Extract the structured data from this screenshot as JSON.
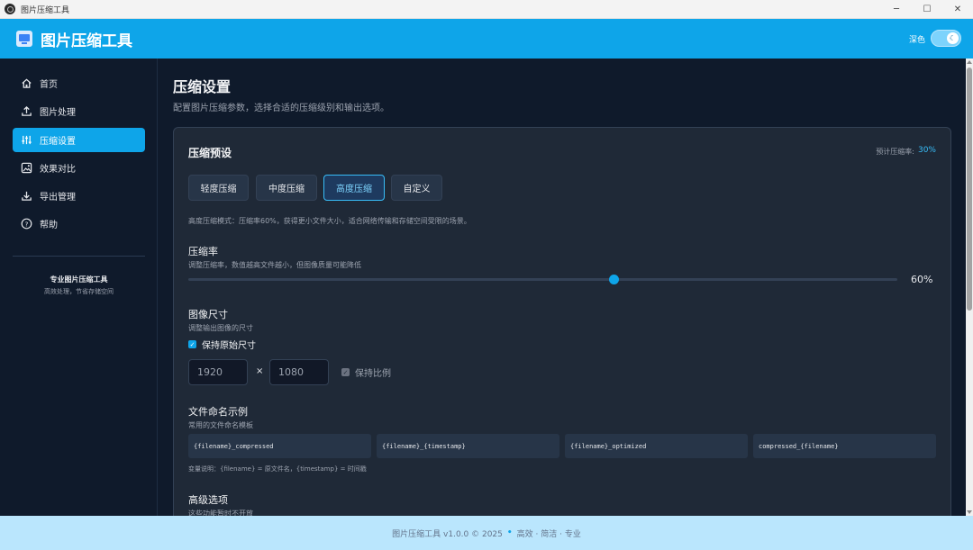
{
  "window": {
    "title": "图片压缩工具",
    "min_icon": "minimize-icon",
    "max_icon": "maximize-icon",
    "close_icon": "close-icon"
  },
  "header": {
    "app_name": "图片压缩工具",
    "theme_label": "深色",
    "theme_dark": true,
    "accent": "#0ea5e9"
  },
  "sidebar": {
    "items": [
      {
        "label": "首页",
        "icon": "home-icon"
      },
      {
        "label": "图片处理",
        "icon": "upload-icon"
      },
      {
        "label": "压缩设置",
        "icon": "sliders-icon",
        "active": true
      },
      {
        "label": "效果对比",
        "icon": "images-icon"
      },
      {
        "label": "导出管理",
        "icon": "download-icon"
      },
      {
        "label": "帮助",
        "icon": "help-icon"
      }
    ],
    "promo_title": "专业图片压缩工具",
    "promo_sub": "高效处理，节省存储空间"
  },
  "main": {
    "title": "压缩设置",
    "desc": "配置图片压缩参数，选择合适的压缩级别和输出选项。",
    "card_title": "压缩预设",
    "ratio_label": "预计压缩率:",
    "ratio_value": "30%",
    "presets": [
      "轻度压缩",
      "中度压缩",
      "高度压缩",
      "自定义"
    ],
    "active_preset": 2,
    "mode_desc": "高度压缩模式：压缩率60%，获得更小文件大小，适合网络传输和存储空间受限的场景。",
    "rate": {
      "title": "压缩率",
      "sub": "调整压缩率，数值越高文件越小，但图像质量可能降低",
      "value": 60,
      "value_label": "60%"
    },
    "size": {
      "title": "图像尺寸",
      "sub": "调整输出图像的尺寸",
      "keep_original_label": "保持原始尺寸",
      "keep_original": true,
      "width": "1920",
      "height": "1080",
      "times": "×",
      "keep_ratio_label": "保持比例",
      "keep_ratio": true
    },
    "naming": {
      "title": "文件命名示例",
      "sub": "常用的文件命名模板",
      "templates": [
        "{filename}_compressed",
        "{filename}_{timestamp}",
        "{filename}_optimized",
        "compressed_{filename}"
      ],
      "note": "变量说明：{filename} = 原文件名，{timestamp} = 时间戳"
    },
    "advanced": {
      "title": "高级选项",
      "sub": "这些功能暂时不开放"
    }
  },
  "footer": {
    "text": "图片压缩工具 v1.0.0 © 2025",
    "dot": "•",
    "tagline": "高效 · 简洁 · 专业"
  }
}
